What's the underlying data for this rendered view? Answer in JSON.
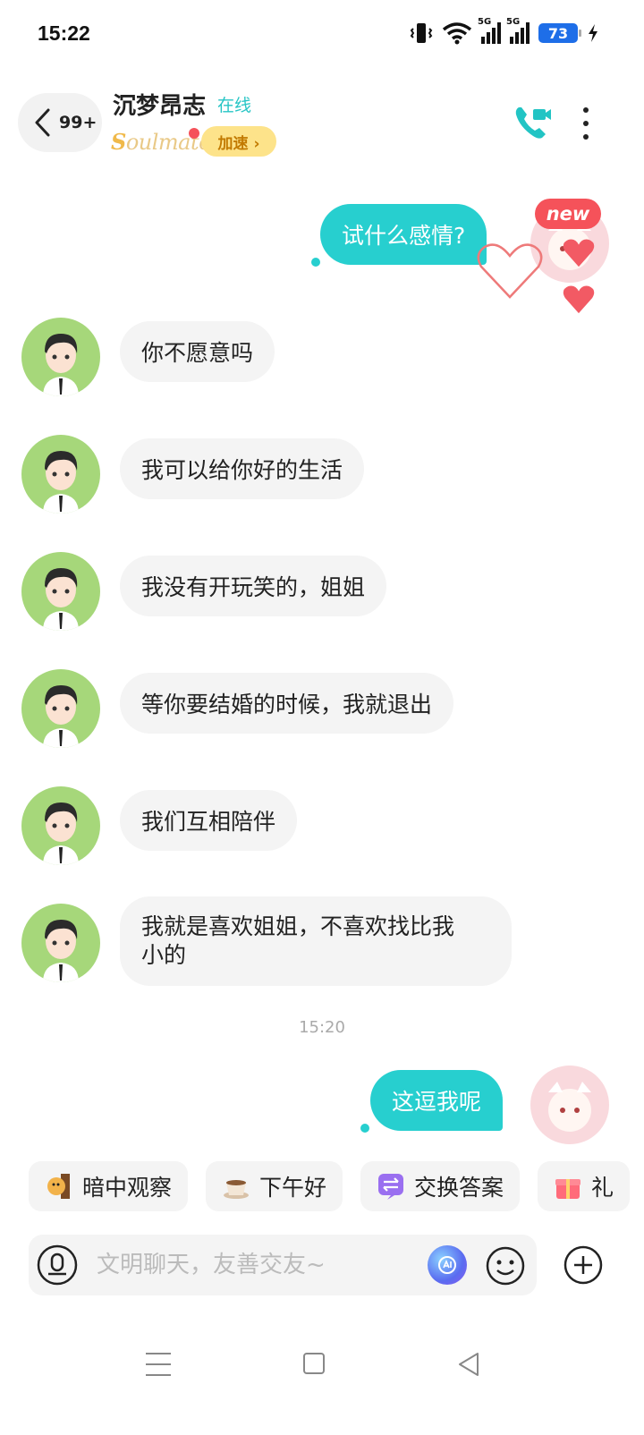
{
  "status_bar": {
    "time": "15:22",
    "signal1_label": "5G",
    "signal2_label": "5G",
    "battery": "73"
  },
  "header": {
    "back_count": "99+",
    "contact_name": "沉梦昂志",
    "online_status": "在线",
    "soulmate_label": "Soulmate",
    "speed_button": "加速 ›"
  },
  "conversation": {
    "new_badge": "new",
    "messages": [
      {
        "side": "out",
        "text": "试什么感情?"
      },
      {
        "side": "in",
        "text": "你不愿意吗"
      },
      {
        "side": "in",
        "text": "我可以给你好的生活"
      },
      {
        "side": "in",
        "text": "我没有开玩笑的，姐姐"
      },
      {
        "side": "in",
        "text": "等你要结婚的时候，我就退出"
      },
      {
        "side": "in",
        "text": "我们互相陪伴"
      },
      {
        "side": "in",
        "text_line1": "我就是喜欢姐姐，不喜欢找比我",
        "text_line2": "小的"
      },
      {
        "side": "out",
        "text": "这逗我呢"
      }
    ],
    "timestamp": "15:20"
  },
  "quick_replies": [
    {
      "label": "暗中观察",
      "icon": "peek-dog-icon"
    },
    {
      "label": "下午好",
      "icon": "coffee-icon"
    },
    {
      "label": "交换答案",
      "icon": "swap-icon"
    },
    {
      "label": "礼",
      "icon": "gift-icon"
    }
  ],
  "input": {
    "placeholder": "文明聊天，友善交友~"
  },
  "colors": {
    "accent": "#27cfcf",
    "badge_red": "#f5525a",
    "speed_yellow": "#fde38a",
    "avatar_green": "#a6d77a"
  }
}
